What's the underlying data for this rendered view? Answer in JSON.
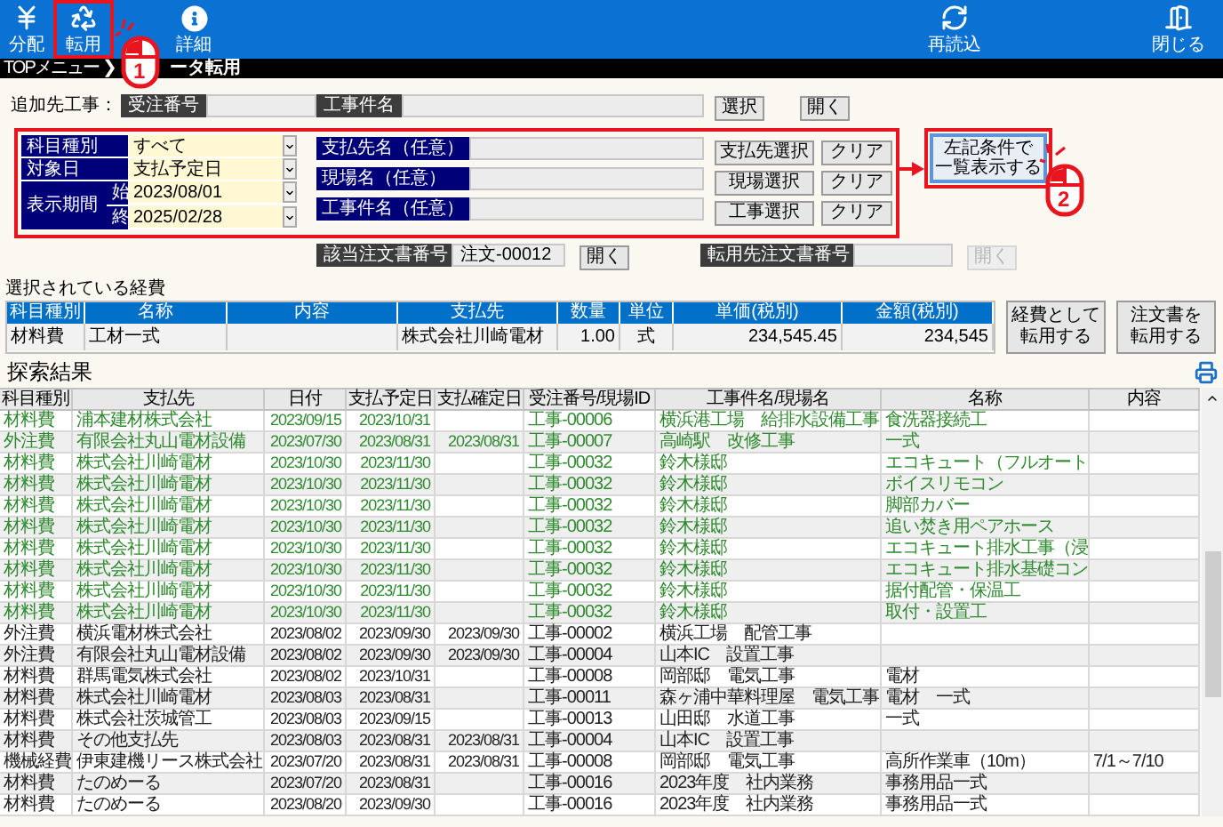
{
  "toolbar": {
    "left": [
      {
        "label": "分配"
      },
      {
        "label": "転用"
      },
      {
        "label": "詳細"
      }
    ],
    "right": [
      {
        "label": "再読込"
      },
      {
        "label": "閉じる"
      }
    ]
  },
  "breadcrumb": {
    "items": [
      "TOPメニュー",
      "ータ転用"
    ],
    "separator": "❯"
  },
  "target_project": {
    "label": "追加先工事：",
    "fields": [
      {
        "label": "受注番号"
      },
      {
        "label": "工事件名"
      }
    ],
    "buttons": [
      "選択",
      "開く"
    ]
  },
  "filters": {
    "selects": [
      {
        "label": "科目種別",
        "value": "すべて"
      },
      {
        "label": "対象日",
        "value": "支払予定日"
      }
    ],
    "period": {
      "label": "表示期間",
      "start_label": "始",
      "start": "2023/08/01",
      "end_label": "終",
      "end": "2025/02/28"
    },
    "text_filters": [
      {
        "label": "支払先名（任意）",
        "select": "支払先選択",
        "clear": "クリア"
      },
      {
        "label": "現場名（任意）",
        "select": "現場選択",
        "clear": "クリア"
      },
      {
        "label": "工事件名（任意）",
        "select": "工事選択",
        "clear": "クリア"
      }
    ],
    "search_button": [
      "左記条件で",
      "一覧表示する"
    ]
  },
  "order_links": [
    {
      "label": "該当注文書番号",
      "value": "注文-00012",
      "button": "開く",
      "disabled": false
    },
    {
      "label": "転用先注文書番号",
      "button": "開く",
      "disabled": true
    }
  ],
  "selected_expense": {
    "title": "選択されている経費",
    "columns": [
      "科目種別",
      "名称",
      "内容",
      "支払先",
      "数量",
      "単位",
      "単価(税別)",
      "金額(税別)"
    ],
    "rows": [
      {
        "category": "材料費",
        "name": "工材一式",
        "payee": "株式会社川崎電材",
        "qty": "1.00",
        "unit": "式",
        "unit_price": "234,545.45",
        "amount": "234,545"
      }
    ],
    "buttons": [
      [
        "経費として",
        "転用する"
      ],
      [
        "注文書を",
        "転用する"
      ]
    ]
  },
  "results": {
    "title": "探索結果",
    "columns": [
      "科目種別",
      "支払先",
      "日付",
      "支払予定日",
      "支払確定日",
      "受注番号/現場ID",
      "工事件名/現場名",
      "名称",
      "内容"
    ],
    "rows": [
      {
        "highlighted": true,
        "category": "材料費",
        "payee": "浦本建材株式会社",
        "date": "2023/09/15",
        "due": "2023/10/31",
        "order_id": "工事-00006",
        "site": "横浜港工場　給排水設備工事",
        "name": "食洗器接続工"
      },
      {
        "highlighted": true,
        "category": "外注費",
        "payee": "有限会社丸山電材設備",
        "date": "2023/07/30",
        "due": "2023/08/31",
        "paid": "2023/08/31",
        "order_id": "工事-00007",
        "site": "高崎駅　改修工事",
        "name": "一式"
      },
      {
        "highlighted": true,
        "category": "材料費",
        "payee": "株式会社川崎電材",
        "date": "2023/10/30",
        "due": "2023/11/30",
        "order_id": "工事-00032",
        "site": "鈴木様邸",
        "name": "エコキュート（フルオート"
      },
      {
        "highlighted": true,
        "category": "材料費",
        "payee": "株式会社川崎電材",
        "date": "2023/10/30",
        "due": "2023/11/30",
        "order_id": "工事-00032",
        "site": "鈴木様邸",
        "name": "ボイスリモコン"
      },
      {
        "highlighted": true,
        "category": "材料費",
        "payee": "株式会社川崎電材",
        "date": "2023/10/30",
        "due": "2023/11/30",
        "order_id": "工事-00032",
        "site": "鈴木様邸",
        "name": "脚部カバー"
      },
      {
        "highlighted": true,
        "category": "材料費",
        "payee": "株式会社川崎電材",
        "date": "2023/10/30",
        "due": "2023/11/30",
        "order_id": "工事-00032",
        "site": "鈴木様邸",
        "name": "追い焚き用ペアホース"
      },
      {
        "highlighted": true,
        "category": "材料費",
        "payee": "株式会社川崎電材",
        "date": "2023/10/30",
        "due": "2023/11/30",
        "order_id": "工事-00032",
        "site": "鈴木様邸",
        "name": "エコキュート排水工事（浸"
      },
      {
        "highlighted": true,
        "category": "材料費",
        "payee": "株式会社川崎電材",
        "date": "2023/10/30",
        "due": "2023/11/30",
        "order_id": "工事-00032",
        "site": "鈴木様邸",
        "name": "エコキュート排水基礎コン"
      },
      {
        "highlighted": true,
        "category": "材料費",
        "payee": "株式会社川崎電材",
        "date": "2023/10/30",
        "due": "2023/11/30",
        "order_id": "工事-00032",
        "site": "鈴木様邸",
        "name": "据付配管・保温工"
      },
      {
        "highlighted": true,
        "category": "材料費",
        "payee": "株式会社川崎電材",
        "date": "2023/10/30",
        "due": "2023/11/30",
        "order_id": "工事-00032",
        "site": "鈴木様邸",
        "name": "取付・設置工"
      },
      {
        "highlighted": false,
        "category": "外注費",
        "payee": "横浜電材株式会社",
        "date": "2023/08/02",
        "due": "2023/09/30",
        "paid": "2023/09/30",
        "order_id": "工事-00002",
        "site": "横浜工場　配管工事"
      },
      {
        "highlighted": false,
        "category": "外注費",
        "payee": "有限会社丸山電材設備",
        "date": "2023/08/02",
        "due": "2023/09/30",
        "paid": "2023/09/30",
        "order_id": "工事-00004",
        "site": "山本IC　設置工事"
      },
      {
        "highlighted": false,
        "category": "材料費",
        "payee": "群馬電気株式会社",
        "date": "2023/08/02",
        "due": "2023/10/31",
        "order_id": "工事-00008",
        "site": "岡部邸　電気工事",
        "name": "電材"
      },
      {
        "highlighted": false,
        "category": "材料費",
        "payee": "株式会社川崎電材",
        "date": "2023/08/03",
        "due": "2023/08/31",
        "order_id": "工事-00011",
        "site": "森ヶ浦中華料理屋　電気工事",
        "name": "電材　一式"
      },
      {
        "highlighted": false,
        "category": "材料費",
        "payee": "株式会社茨城管工",
        "date": "2023/08/03",
        "due": "2023/09/15",
        "order_id": "工事-00013",
        "site": "山田邸　水道工事",
        "name": "一式"
      },
      {
        "highlighted": false,
        "category": "材料費",
        "payee": "その他支払先",
        "date": "2023/08/03",
        "due": "2023/08/31",
        "paid": "2023/08/31",
        "order_id": "工事-00004",
        "site": "山本IC　設置工事"
      },
      {
        "highlighted": false,
        "category": "機械経費",
        "payee": "伊東建機リース株式会社",
        "date": "2023/07/20",
        "due": "2023/08/31",
        "paid": "2023/08/31",
        "order_id": "工事-00008",
        "site": "岡部邸　電気工事",
        "name": "高所作業車（10m）",
        "content": "7/1～7/10"
      },
      {
        "highlighted": false,
        "category": "材料費",
        "payee": "たのめーる",
        "date": "2023/07/20",
        "due": "2023/08/31",
        "order_id": "工事-00016",
        "site": "2023年度　社内業務",
        "name": "事務用品一式"
      },
      {
        "highlighted": false,
        "category": "材料費",
        "payee": "たのめーる",
        "date": "2023/08/20",
        "due": "2023/09/30",
        "order_id": "工事-00016",
        "site": "2023年度　社内業務",
        "name": "事務用品一式"
      }
    ]
  },
  "annotations": {
    "steps": [
      "1",
      "2"
    ]
  }
}
